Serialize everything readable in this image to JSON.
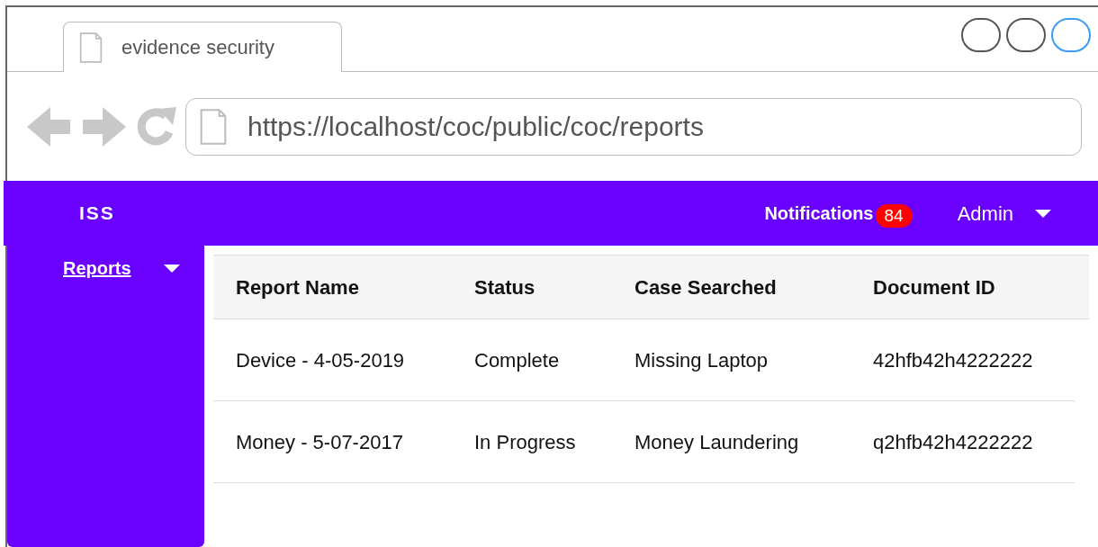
{
  "browser": {
    "tab_title": "evidence security",
    "url": "https://localhost/coc/public/coc/reports"
  },
  "navbar": {
    "brand": "ISS",
    "notifications_label": "Notifications",
    "notifications_count": "84",
    "user": "Admin"
  },
  "sidebar": {
    "items": [
      {
        "label": "Reports",
        "selected": true
      }
    ]
  },
  "table": {
    "columns": [
      "Report Name",
      "Status",
      "Case Searched",
      "Document ID"
    ],
    "rows": [
      [
        "Device - 4-05-2019",
        "Complete",
        "Missing Laptop",
        "42hfb42h4222222"
      ],
      [
        "Money - 5-07-2017",
        "In Progress",
        "Money Laundering",
        "q2hfb42h4222222"
      ]
    ]
  }
}
